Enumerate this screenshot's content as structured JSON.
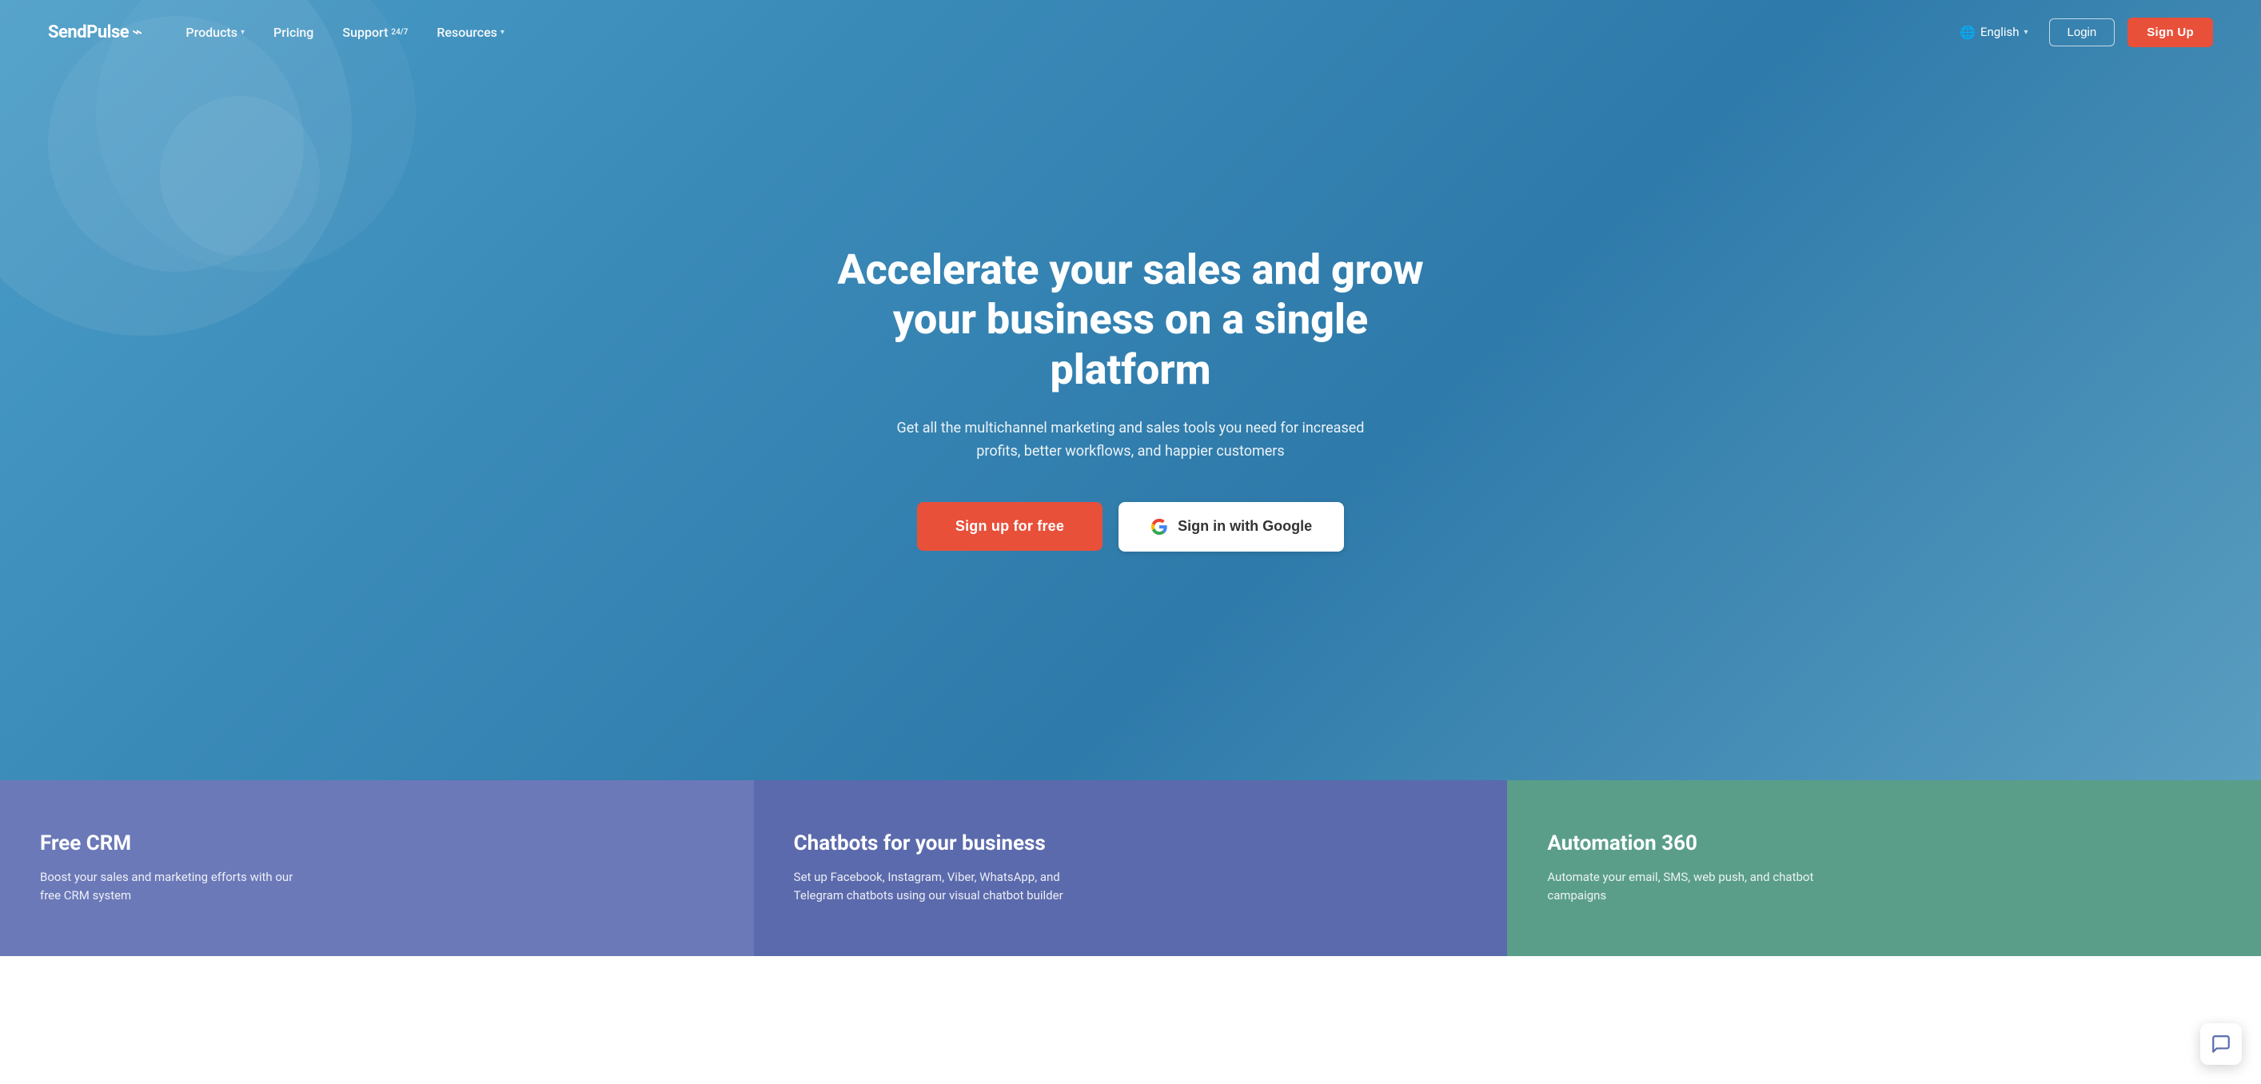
{
  "nav": {
    "logo_text": "SendPulse",
    "logo_symbol": "⌁",
    "products_label": "Products",
    "pricing_label": "Pricing",
    "support_label": "Support",
    "support_sup": "24/7",
    "resources_label": "Resources",
    "lang_label": "English",
    "login_label": "Login",
    "signup_label": "Sign Up"
  },
  "hero": {
    "title": "Accelerate your sales and grow your business on a single platform",
    "subtitle": "Get all the multichannel marketing and sales tools you need for increased profits, better workflows, and happier customers",
    "cta_primary": "Sign up for free",
    "cta_google": "Sign in with Google"
  },
  "features": [
    {
      "title": "Free CRM",
      "desc": "Boost your sales and marketing efforts with our free CRM system"
    },
    {
      "title": "Chatbots for your business",
      "desc": "Set up Facebook, Instagram, Viber, WhatsApp, and Telegram chatbots using our visual chatbot builder"
    },
    {
      "title": "Automation 360",
      "desc": "Automate your email, SMS, web push, and chatbot campaigns"
    }
  ]
}
